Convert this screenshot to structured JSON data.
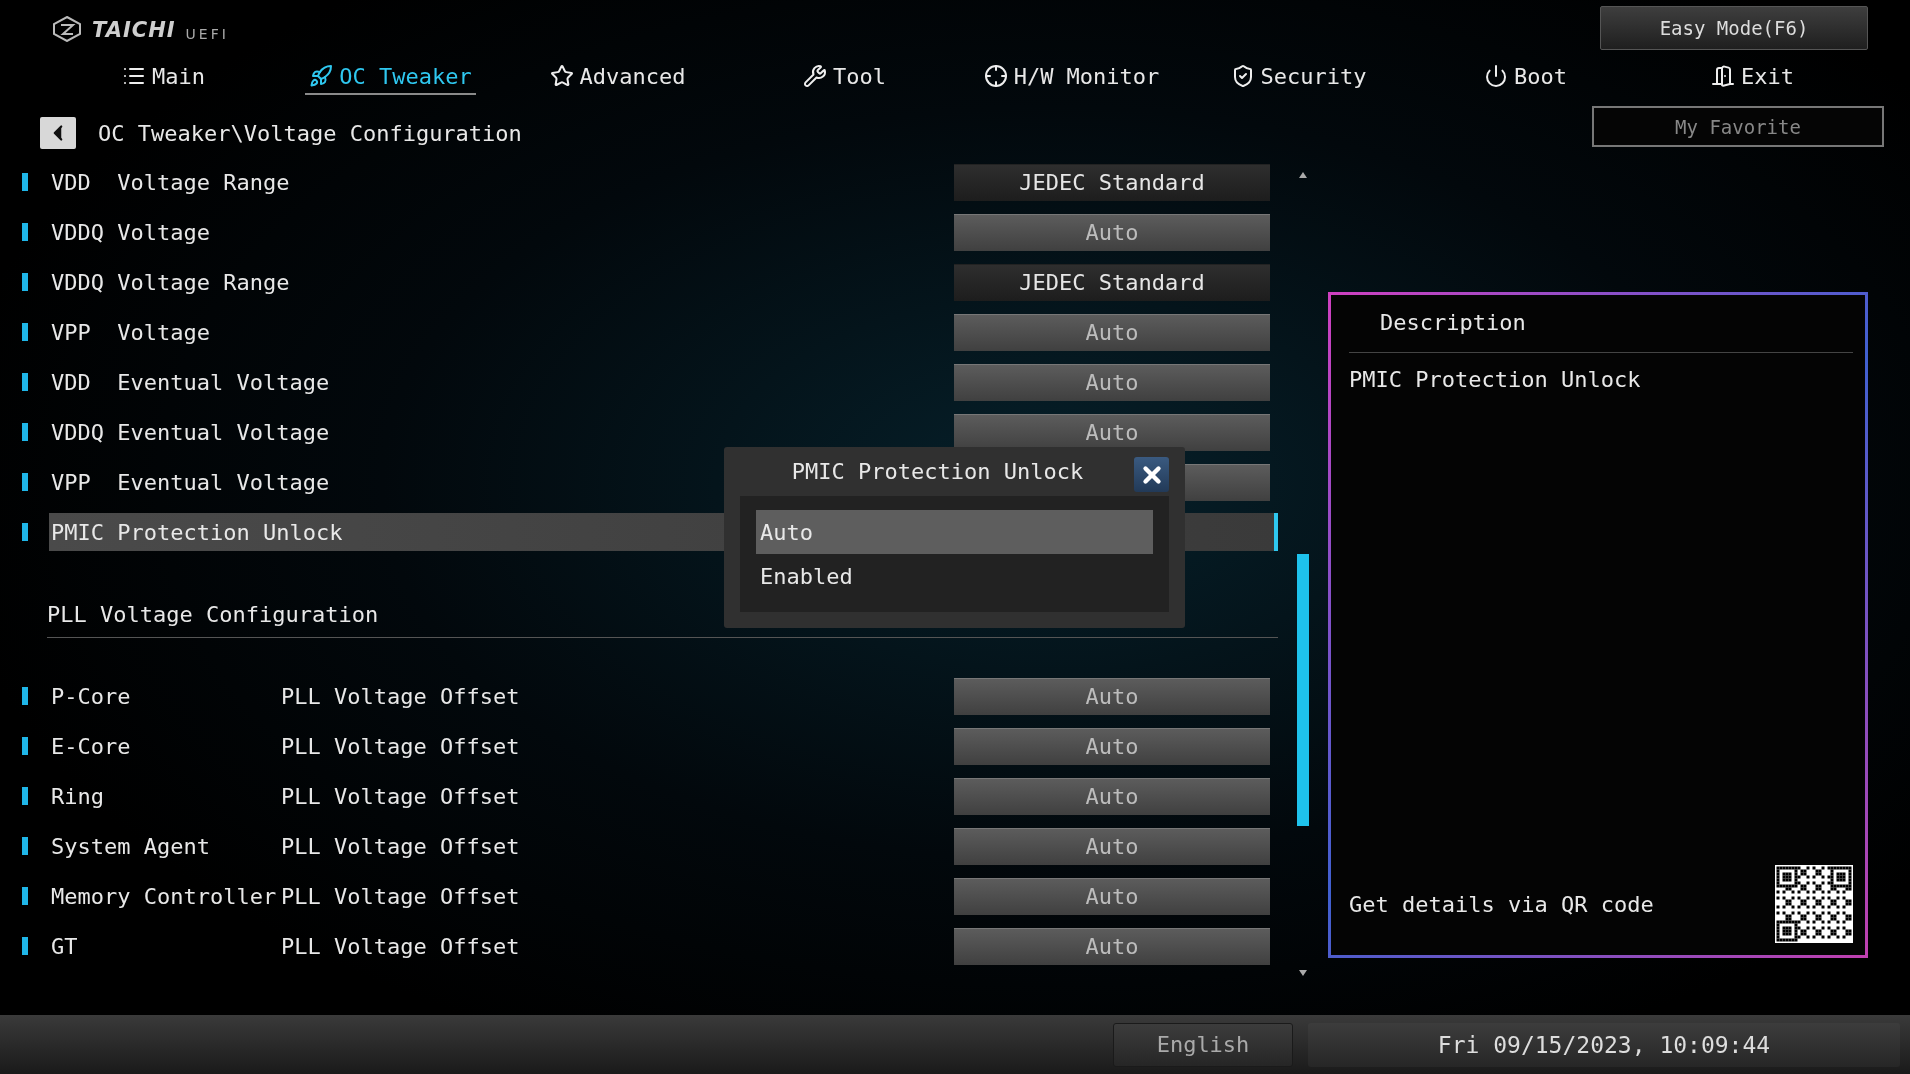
{
  "logo": {
    "brand": "TAICHI",
    "suffix": "UEFI"
  },
  "easy_mode_button": "Easy Mode(F6)",
  "tabs": [
    {
      "label": "Main",
      "selected": false
    },
    {
      "label": "OC Tweaker",
      "selected": true
    },
    {
      "label": "Advanced",
      "selected": false
    },
    {
      "label": "Tool",
      "selected": false
    },
    {
      "label": "H/W Monitor",
      "selected": false
    },
    {
      "label": "Security",
      "selected": false
    },
    {
      "label": "Boot",
      "selected": false
    },
    {
      "label": "Exit",
      "selected": false
    }
  ],
  "breadcrumb": "OC Tweaker\\Voltage Configuration",
  "favorite_button": "My Favorite",
  "settings": [
    {
      "kind": "setting",
      "label": "VDD  Voltage Range",
      "value": "JEDEC Standard",
      "readonly": true,
      "selected": false
    },
    {
      "kind": "setting",
      "label": "VDDQ Voltage",
      "value": "Auto",
      "readonly": false,
      "selected": false
    },
    {
      "kind": "setting",
      "label": "VDDQ Voltage Range",
      "value": "JEDEC Standard",
      "readonly": true,
      "selected": false
    },
    {
      "kind": "setting",
      "label": "VPP  Voltage",
      "value": "Auto",
      "readonly": false,
      "selected": false
    },
    {
      "kind": "setting",
      "label": "VDD  Eventual Voltage",
      "value": "Auto",
      "readonly": false,
      "selected": false
    },
    {
      "kind": "setting",
      "label": "VDDQ Eventual Voltage",
      "value": "Auto",
      "readonly": false,
      "selected": false
    },
    {
      "kind": "setting",
      "label": "VPP  Eventual Voltage",
      "readonly": false,
      "selected": false
    },
    {
      "kind": "setting",
      "label": "PMIC Protection Unlock",
      "selected": true
    },
    {
      "kind": "heading",
      "label": "PLL Voltage Configuration"
    },
    {
      "kind": "setting",
      "label": "P-Core",
      "sublabel": "PLL Voltage Offset",
      "value": "Auto",
      "readonly": false,
      "selected": false
    },
    {
      "kind": "setting",
      "label": "E-Core",
      "sublabel": "PLL Voltage Offset",
      "value": "Auto",
      "readonly": false,
      "selected": false
    },
    {
      "kind": "setting",
      "label": "Ring",
      "sublabel": "PLL Voltage Offset",
      "value": "Auto",
      "readonly": false,
      "selected": false
    },
    {
      "kind": "setting",
      "label": "System Agent",
      "sublabel": "PLL Voltage Offset",
      "value": "Auto",
      "readonly": false,
      "selected": false
    },
    {
      "kind": "setting",
      "label": "Memory Controller",
      "sublabel": "PLL Voltage Offset",
      "value": "Auto",
      "readonly": false,
      "selected": false
    },
    {
      "kind": "setting",
      "label": "GT",
      "sublabel": "PLL Voltage Offset",
      "value": "Auto",
      "readonly": false,
      "selected": false
    }
  ],
  "popup": {
    "title": "PMIC Protection Unlock",
    "options": [
      {
        "label": "Auto",
        "selected": true
      },
      {
        "label": "Enabled",
        "selected": false
      }
    ]
  },
  "description": {
    "title": "Description",
    "text": "PMIC Protection Unlock",
    "qr_hint": "Get details via QR code"
  },
  "status_bar": {
    "language": "English",
    "datetime": "Fri 09/15/2023, 10:09:44"
  }
}
